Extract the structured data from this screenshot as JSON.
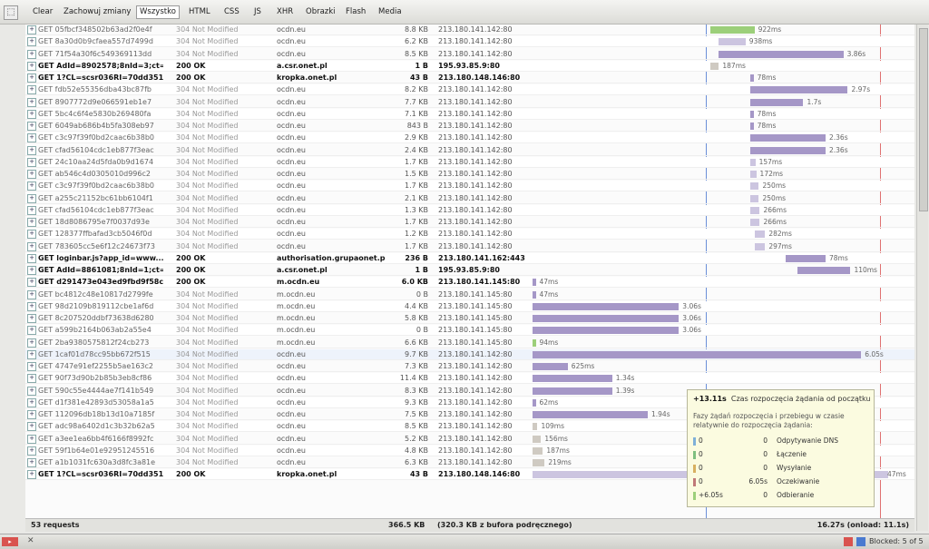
{
  "toolbar": {
    "buttons": [
      "Clear",
      "Zachowuj zmiany",
      "Wszystko",
      "HTML",
      "CSS",
      "JS",
      "XHR",
      "Obrazki",
      "Flash",
      "Media"
    ],
    "selected": "Wszystko"
  },
  "requests": [
    {
      "url": "GET 05fbcf348502b63ad2f0e4f",
      "status": "304 Not Modified",
      "domain": "ocdn.eu",
      "size": "8.8 KB",
      "ip": "213.180.141.142:80",
      "bar_start": 0.77,
      "bar_width": 0.05,
      "label": "922ms",
      "style": "green"
    },
    {
      "url": "GET 8a30d0b9cfaea557d7499d",
      "status": "304 Not Modified",
      "domain": "ocdn.eu",
      "size": "6.2 KB",
      "ip": "213.180.141.142:80",
      "bar_start": 0.78,
      "bar_width": 0.03,
      "label": "938ms",
      "style": "light"
    },
    {
      "url": "GET 71f54a30f6c549369113dd",
      "status": "304 Not Modified",
      "domain": "ocdn.eu",
      "size": "8.5 KB",
      "ip": "213.180.141.142:80",
      "bar_start": 0.78,
      "bar_width": 0.14,
      "label": "3.86s",
      "style": "purple"
    },
    {
      "url": "GET AdId=8902578;8nId=3;ct=",
      "status": "200 OK",
      "domain": "a.csr.onet.pl",
      "size": "1 B",
      "ip": "195.93.85.9:80",
      "bar_start": 0.77,
      "bar_width": 0.01,
      "label": "187ms",
      "style": "grey",
      "bold": true
    },
    {
      "url": "GET 1?CL=scsr036RI=70dd351",
      "status": "200 OK",
      "domain": "kropka.onet.pl",
      "size": "43 B",
      "ip": "213.180.148.146:80",
      "bar_start": 0.815,
      "bar_width": 0.004,
      "label": "78ms",
      "style": "purple",
      "bold": true
    },
    {
      "url": "GET fdb52e55356dba43bc87fb",
      "status": "304 Not Modified",
      "domain": "ocdn.eu",
      "size": "8.2 KB",
      "ip": "213.180.141.142:80",
      "bar_start": 0.815,
      "bar_width": 0.11,
      "label": "2.97s",
      "style": "purple"
    },
    {
      "url": "GET 8907772d9e066591eb1e7",
      "status": "304 Not Modified",
      "domain": "ocdn.eu",
      "size": "7.7 KB",
      "ip": "213.180.141.142:80",
      "bar_start": 0.815,
      "bar_width": 0.06,
      "label": "1.7s",
      "style": "purple"
    },
    {
      "url": "GET 5bc4c6f4e5830b269480fa",
      "status": "304 Not Modified",
      "domain": "ocdn.eu",
      "size": "7.1 KB",
      "ip": "213.180.141.142:80",
      "bar_start": 0.815,
      "bar_width": 0.004,
      "label": "78ms",
      "style": "purple"
    },
    {
      "url": "GET 6049ab686b4b5fa308eb97",
      "status": "304 Not Modified",
      "domain": "ocdn.eu",
      "size": "843 B",
      "ip": "213.180.141.142:80",
      "bar_start": 0.815,
      "bar_width": 0.004,
      "label": "78ms",
      "style": "purple"
    },
    {
      "url": "GET c3c97f39f0bd2caac6b38b0",
      "status": "304 Not Modified",
      "domain": "ocdn.eu",
      "size": "2.9 KB",
      "ip": "213.180.141.142:80",
      "bar_start": 0.815,
      "bar_width": 0.085,
      "label": "2.36s",
      "style": "purple"
    },
    {
      "url": "GET cfad56104cdc1eb877f3eac",
      "status": "304 Not Modified",
      "domain": "ocdn.eu",
      "size": "2.4 KB",
      "ip": "213.180.141.142:80",
      "bar_start": 0.815,
      "bar_width": 0.085,
      "label": "2.36s",
      "style": "purple"
    },
    {
      "url": "GET 24c10aa24d5fda0b9d1674",
      "status": "304 Not Modified",
      "domain": "ocdn.eu",
      "size": "1.7 KB",
      "ip": "213.180.141.142:80",
      "bar_start": 0.815,
      "bar_width": 0.006,
      "label": "157ms",
      "style": "light"
    },
    {
      "url": "GET ab546c4d0305010d996c2",
      "status": "304 Not Modified",
      "domain": "ocdn.eu",
      "size": "1.5 KB",
      "ip": "213.180.141.142:80",
      "bar_start": 0.815,
      "bar_width": 0.007,
      "label": "172ms",
      "style": "light"
    },
    {
      "url": "GET c3c97f39f0bd2caac6b38b0",
      "status": "304 Not Modified",
      "domain": "ocdn.eu",
      "size": "1.7 KB",
      "ip": "213.180.141.142:80",
      "bar_start": 0.815,
      "bar_width": 0.01,
      "label": "250ms",
      "style": "light"
    },
    {
      "url": "GET a255c21152bc61bb6104f1",
      "status": "304 Not Modified",
      "domain": "ocdn.eu",
      "size": "2.1 KB",
      "ip": "213.180.141.142:80",
      "bar_start": 0.815,
      "bar_width": 0.01,
      "label": "250ms",
      "style": "light"
    },
    {
      "url": "GET cfad56104cdc1eb877f3eac",
      "status": "304 Not Modified",
      "domain": "ocdn.eu",
      "size": "1.3 KB",
      "ip": "213.180.141.142:80",
      "bar_start": 0.815,
      "bar_width": 0.011,
      "label": "266ms",
      "style": "light"
    },
    {
      "url": "GET 18d8086795e7f0037d93e",
      "status": "304 Not Modified",
      "domain": "ocdn.eu",
      "size": "1.7 KB",
      "ip": "213.180.141.142:80",
      "bar_start": 0.815,
      "bar_width": 0.011,
      "label": "266ms",
      "style": "light"
    },
    {
      "url": "GET 128377ffbafad3cb5046f0d",
      "status": "304 Not Modified",
      "domain": "ocdn.eu",
      "size": "1.2 KB",
      "ip": "213.180.141.142:80",
      "bar_start": 0.82,
      "bar_width": 0.012,
      "label": "282ms",
      "style": "light"
    },
    {
      "url": "GET 783605cc5e6f12c24673f73",
      "status": "304 Not Modified",
      "domain": "ocdn.eu",
      "size": "1.7 KB",
      "ip": "213.180.141.142:80",
      "bar_start": 0.82,
      "bar_width": 0.012,
      "label": "297ms",
      "style": "light"
    },
    {
      "url": "GET loginbar.js?app_id=www....",
      "status": "200 OK",
      "domain": "authorisation.grupaonet.pl",
      "size": "236 B",
      "ip": "213.180.141.162:443",
      "bar_start": 0.855,
      "bar_width": 0.045,
      "label": "78ms",
      "style": "purple",
      "bold": true
    },
    {
      "url": "GET AdId=8861081;8nId=1;ct=",
      "status": "200 OK",
      "domain": "a.csr.onet.pl",
      "size": "1 B",
      "ip": "195.93.85.9:80",
      "bar_start": 0.868,
      "bar_width": 0.06,
      "label": "110ms",
      "style": "purple",
      "bold": true
    },
    {
      "url": "GET d291473e043ed9fbd9f58c",
      "status": "200 OK",
      "domain": "m.ocdn.eu",
      "size": "6.0 KB",
      "ip": "213.180.141.145:80",
      "bar_start": 0.57,
      "bar_width": 0.004,
      "label": "47ms",
      "style": "purple",
      "bold": true
    },
    {
      "url": "GET bc4812c48e10817d2799fe",
      "status": "304 Not Modified",
      "domain": "m.ocdn.eu",
      "size": "0 B",
      "ip": "213.180.141.145:80",
      "bar_start": 0.57,
      "bar_width": 0.004,
      "label": "47ms",
      "style": "purple"
    },
    {
      "url": "GET 98d2109b819112cbe1af6d",
      "status": "304 Not Modified",
      "domain": "m.ocdn.eu",
      "size": "4.4 KB",
      "ip": "213.180.141.145:80",
      "bar_start": 0.57,
      "bar_width": 0.165,
      "label": "3.06s",
      "style": "purple"
    },
    {
      "url": "GET 8c207520ddbf73638d6280",
      "status": "304 Not Modified",
      "domain": "m.ocdn.eu",
      "size": "5.8 KB",
      "ip": "213.180.141.145:80",
      "bar_start": 0.57,
      "bar_width": 0.165,
      "label": "3.06s",
      "style": "purple"
    },
    {
      "url": "GET a599b2164b063ab2a55e4",
      "status": "304 Not Modified",
      "domain": "m.ocdn.eu",
      "size": "0 B",
      "ip": "213.180.141.145:80",
      "bar_start": 0.57,
      "bar_width": 0.165,
      "label": "3.06s",
      "style": "purple"
    },
    {
      "url": "GET 2ba9380575812f24cb273",
      "status": "304 Not Modified",
      "domain": "m.ocdn.eu",
      "size": "6.6 KB",
      "ip": "213.180.141.145:80",
      "bar_start": 0.57,
      "bar_width": 0.004,
      "label": "94ms",
      "style": "green"
    },
    {
      "url": "GET 1caf01d78cc95bb672f515",
      "status": "304 Not Modified",
      "domain": "ocdn.eu",
      "size": "9.7 KB",
      "ip": "213.180.141.142:80",
      "bar_start": 0.57,
      "bar_width": 0.37,
      "label": "6.05s",
      "style": "purple",
      "highlight": true
    },
    {
      "url": "GET 4747e91ef2255b5ae163c2",
      "status": "304 Not Modified",
      "domain": "ocdn.eu",
      "size": "7.3 KB",
      "ip": "213.180.141.142:80",
      "bar_start": 0.57,
      "bar_width": 0.04,
      "label": "625ms",
      "style": "purple"
    },
    {
      "url": "GET 90f73d90b2b85b3eb8cf86",
      "status": "304 Not Modified",
      "domain": "ocdn.eu",
      "size": "11.4 KB",
      "ip": "213.180.141.142:80",
      "bar_start": 0.57,
      "bar_width": 0.09,
      "label": "1.34s",
      "style": "purple"
    },
    {
      "url": "GET 590c55e4444ae7f141b549",
      "status": "304 Not Modified",
      "domain": "ocdn.eu",
      "size": "8.3 KB",
      "ip": "213.180.141.142:80",
      "bar_start": 0.57,
      "bar_width": 0.09,
      "label": "1.39s",
      "style": "purple"
    },
    {
      "url": "GET d1f381e42893d53058a1a5",
      "status": "304 Not Modified",
      "domain": "ocdn.eu",
      "size": "9.3 KB",
      "ip": "213.180.141.142:80",
      "bar_start": 0.57,
      "bar_width": 0.004,
      "label": "62ms",
      "style": "purple"
    },
    {
      "url": "GET 112096db18b13d10a7185f",
      "status": "304 Not Modified",
      "domain": "ocdn.eu",
      "size": "7.5 KB",
      "ip": "213.180.141.142:80",
      "bar_start": 0.57,
      "bar_width": 0.13,
      "label": "1.94s",
      "style": "purple"
    },
    {
      "url": "GET adc98a6402d1c3b32b62a5",
      "status": "304 Not Modified",
      "domain": "ocdn.eu",
      "size": "8.5 KB",
      "ip": "213.180.141.142:80",
      "bar_start": 0.57,
      "bar_width": 0.006,
      "label": "109ms",
      "style": "grey"
    },
    {
      "url": "GET a3ee1ea6bb4f6166f8992fc",
      "status": "304 Not Modified",
      "domain": "ocdn.eu",
      "size": "5.2 KB",
      "ip": "213.180.141.142:80",
      "bar_start": 0.57,
      "bar_width": 0.01,
      "label": "156ms",
      "style": "grey"
    },
    {
      "url": "GET 59f1b64e01e92951245516",
      "status": "304 Not Modified",
      "domain": "ocdn.eu",
      "size": "4.8 KB",
      "ip": "213.180.141.142:80",
      "bar_start": 0.57,
      "bar_width": 0.012,
      "label": "187ms",
      "style": "grey"
    },
    {
      "url": "GET a1b1031fc630a3d8fc3a81e",
      "status": "304 Not Modified",
      "domain": "ocdn.eu",
      "size": "6.3 KB",
      "ip": "213.180.141.142:80",
      "bar_start": 0.57,
      "bar_width": 0.014,
      "label": "219ms",
      "style": "grey"
    },
    {
      "url": "GET 1?CL=scsr036RI=70dd351",
      "status": "200 OK",
      "domain": "kropka.onet.pl",
      "size": "43 B",
      "ip": "213.180.148.146:80",
      "bar_start": 0.57,
      "bar_width": 0.4,
      "label": "47ms",
      "style": "light",
      "bold": true
    }
  ],
  "footer": {
    "count": "53 requests",
    "size": "366.5 KB",
    "cache": "(320.3 KB z bufora podręcznego)",
    "time": "16.27s (onload: 11.1s)"
  },
  "tooltip": {
    "start": "+13.11s",
    "start_label": "Czas rozpoczęcia żądania od początku",
    "desc": "Fazy żądań rozpoczęcia i przebiegu w czasie relatywnie do rozpoczęcia żądania:",
    "phases": [
      {
        "v1": "0",
        "v2": "0",
        "name": "Odpytywanie DNS",
        "color": "#7fb0d8"
      },
      {
        "v1": "0",
        "v2": "0",
        "name": "Łączenie",
        "color": "#7fbf7f"
      },
      {
        "v1": "0",
        "v2": "0",
        "name": "Wysyłanie",
        "color": "#d8b060"
      },
      {
        "v1": "0",
        "v2": "6.05s",
        "name": "Oczekiwanie",
        "color": "#c07878"
      },
      {
        "v1": "+6.05s",
        "v2": "0",
        "name": "Odbieranie",
        "color": "#9ccf7a"
      }
    ]
  },
  "statusbar": {
    "blocked": "Blocked: 5 of 5"
  }
}
